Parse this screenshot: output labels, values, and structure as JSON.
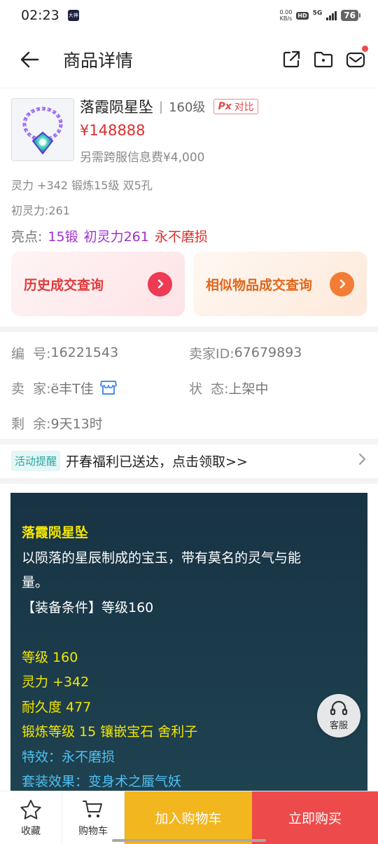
{
  "status_bar": {
    "time": "02:23",
    "app_badge": "大神",
    "speed_value": "0.00",
    "speed_unit": "KB/s",
    "hd": "HD",
    "network": "5G",
    "battery": "76"
  },
  "header": {
    "title": "商品详情"
  },
  "product": {
    "name": "落霞陨星坠",
    "level": "160级",
    "compare_icon": "Px",
    "compare_label": "对比",
    "price": "¥148888",
    "cross_server_fee": "另需跨服信息费¥4,000",
    "attributes": "灵力 +342 锻炼15级 双5孔",
    "initial_spirit": "初灵力:261",
    "highlights_label": "亮点:",
    "highlights": [
      "15锻",
      "初灵力261",
      "永不磨损"
    ]
  },
  "query_buttons": {
    "history": "历史成交查询",
    "similar": "相似物品成交查询"
  },
  "seller_info": {
    "id_label": "编  号:",
    "id_value": "16221543",
    "seller_id_label": "卖家ID:",
    "seller_id_value": "67679893",
    "seller_label": "卖  家:",
    "seller_value": "ë丰T佳",
    "status_label": "状  态:",
    "status_value": "上架中",
    "remaining_label": "剩  余:",
    "remaining_value": "9天13时"
  },
  "activity": {
    "tag": "活动提醒",
    "message": "开春福利已送达，点击领取>>"
  },
  "description": {
    "title": "落霞陨星坠",
    "intro_1": "以陨落的星辰制成的宝玉，带有莫名的灵气与能",
    "intro_2": "量。",
    "requirement": "【装备条件】等级160",
    "stat_level": "等级 160",
    "stat_spirit": "灵力 +342",
    "stat_durability": "耐久度 477",
    "stat_forge": "锻炼等级 15 镶嵌宝石 舍利子",
    "effect": "特效：永不磨损",
    "set_effect": "套装效果：变身术之蜃气妖"
  },
  "service": {
    "label": "客服"
  },
  "bottom_bar": {
    "favorite": "收藏",
    "cart": "购物车",
    "add_to_cart": "加入购物车",
    "buy_now": "立即购买"
  },
  "colors": {
    "price_red": "#e02d2d",
    "highlight_purple": "#a02fd6",
    "add_cart_yellow": "#f2b61e",
    "buy_red": "#ed4b4b",
    "panel_bg": "#173344",
    "desc_yellow": "#f5e600",
    "desc_blue": "#4ec0f2"
  }
}
